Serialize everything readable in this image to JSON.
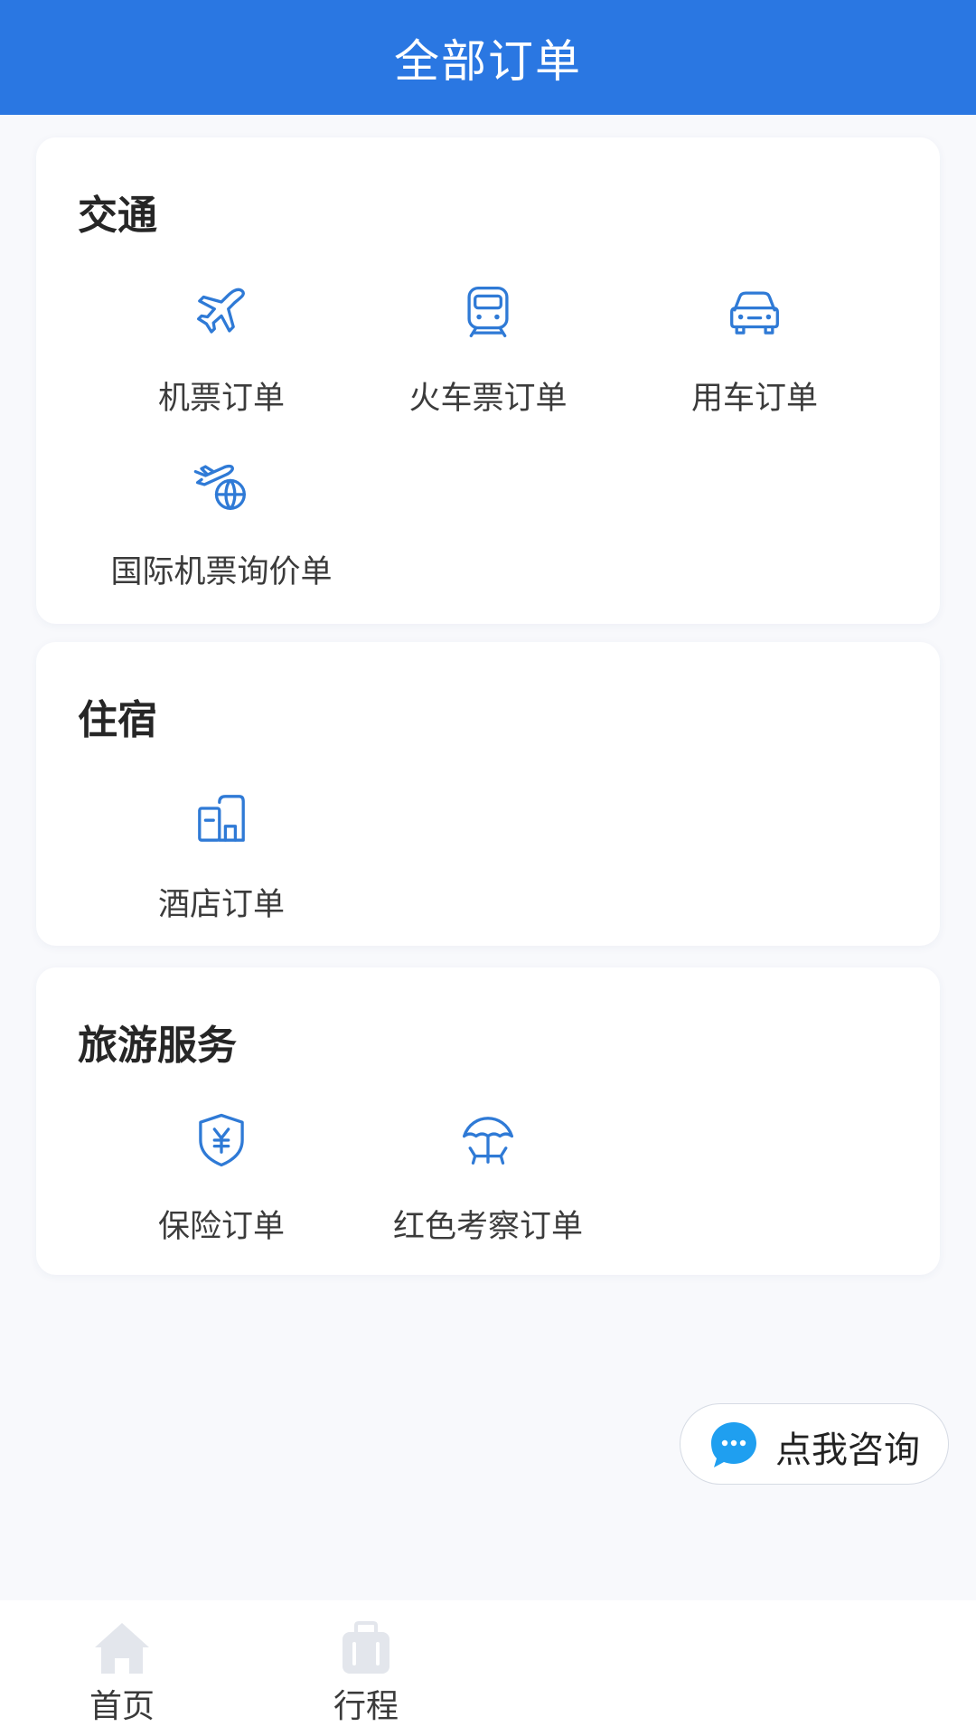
{
  "header": {
    "title": "全部订单"
  },
  "sections": [
    {
      "title": "交通",
      "items": [
        {
          "label": "机票订单",
          "icon": "airplane-icon"
        },
        {
          "label": "火车票订单",
          "icon": "train-icon"
        },
        {
          "label": "用车订单",
          "icon": "car-icon"
        },
        {
          "label": "国际机票询价单",
          "icon": "international-flight-icon"
        }
      ]
    },
    {
      "title": "住宿",
      "items": [
        {
          "label": "酒店订单",
          "icon": "hotel-icon"
        }
      ]
    },
    {
      "title": "旅游服务",
      "items": [
        {
          "label": "保险订单",
          "icon": "insurance-shield-icon"
        },
        {
          "label": "红色考察订单",
          "icon": "beach-umbrella-icon"
        }
      ]
    }
  ],
  "consult": {
    "label": "点我咨询",
    "icon": "chat-bubble-icon"
  },
  "tabbar": {
    "items": [
      {
        "label": "首页",
        "icon": "home-icon"
      },
      {
        "label": "行程",
        "icon": "luggage-icon"
      }
    ]
  },
  "colors": {
    "header_bg": "#2a77e2",
    "icon_blue": "#2f7ad6",
    "chat_blue": "#1f9ff0",
    "tab_icon_gray": "#e3e6ec",
    "page_bg": "#f8f9fc"
  }
}
